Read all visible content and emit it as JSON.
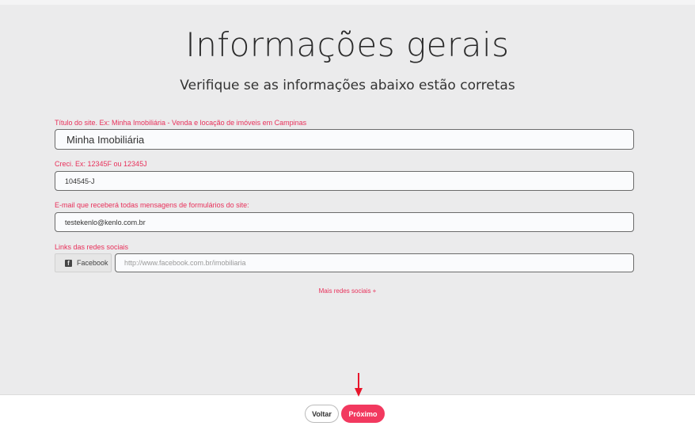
{
  "page": {
    "title": "Informações gerais",
    "subtitle": "Verifique se as informações abaixo estão corretas"
  },
  "form": {
    "site_title": {
      "label": "Título do site. Ex: Minha Imobiliária - Venda e locação de imóveis em Campinas",
      "value": "Minha Imobiliária"
    },
    "creci": {
      "label": "Creci. Ex: 12345F ou 12345J",
      "value": "104545-J"
    },
    "email": {
      "label": "E-mail que receberá todas mensagens de formulários do site:",
      "value": "testekenlo@kenlo.com.br"
    },
    "social": {
      "label": "Links das redes sociais",
      "facebook_label": "Facebook",
      "facebook_placeholder": "http://www.facebook.com.br/imobiliaria"
    },
    "more_social_link": "Mais redes sociais +"
  },
  "footer": {
    "back_label": "Voltar",
    "next_label": "Próximo"
  },
  "colors": {
    "accent": "#f2395f",
    "label": "#e8305a",
    "annotation_arrow": "#e8152b",
    "background": "#ebebec"
  },
  "icons": {
    "facebook": "facebook-icon",
    "annotation": "red-arrow-down-icon"
  }
}
